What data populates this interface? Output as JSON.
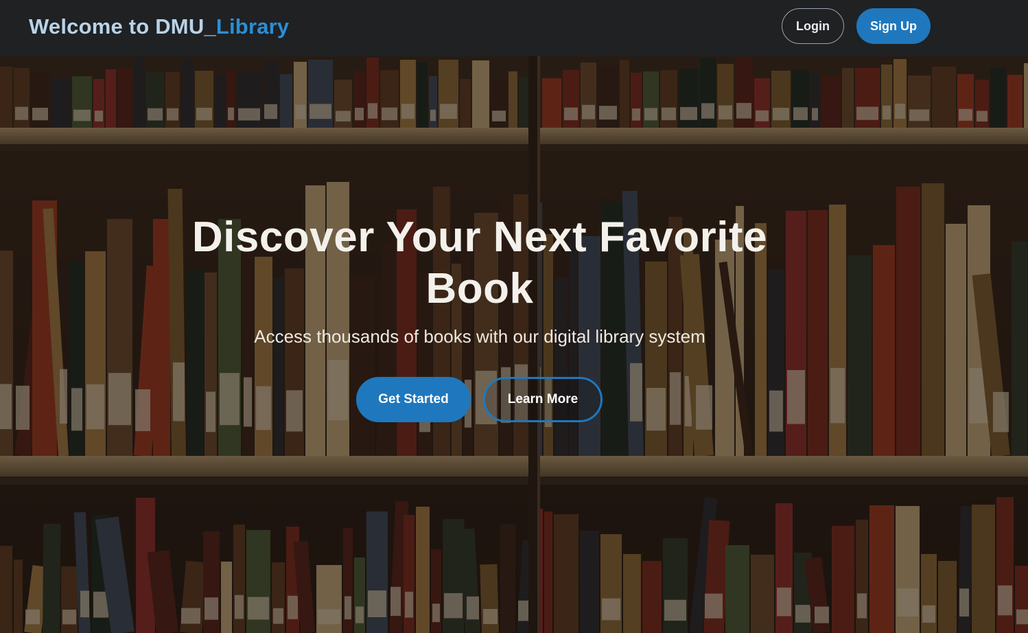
{
  "header": {
    "brand_prefix": "Welcome to DMU_",
    "brand_accent": "Library",
    "login_label": "Login",
    "signup_label": "Sign Up"
  },
  "hero": {
    "title": "Discover Your Next Favorite Book",
    "subtitle": "Access thousands of books with our digital library system",
    "primary_cta": "Get Started",
    "secondary_cta": "Learn More"
  },
  "colors": {
    "header_bg": "#1f2123",
    "brand_text": "#b9d3e8",
    "brand_accent": "#2b8fd6",
    "primary_button": "#1f78bd",
    "hero_text": "#f4f1ec"
  },
  "icons": {
    "background_image": "library-bookshelves-image"
  }
}
